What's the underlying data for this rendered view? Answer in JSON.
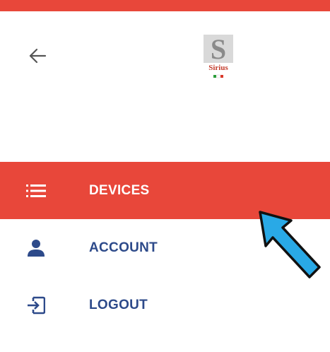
{
  "header": {
    "back_icon": "arrow-left-icon",
    "logo_text": "Sirius",
    "accent_color": "#e8473a"
  },
  "menu": {
    "items": [
      {
        "label": "DEVICES",
        "icon": "list-icon",
        "active": true
      },
      {
        "label": "ACCOUNT",
        "icon": "person-icon",
        "active": false
      },
      {
        "label": "LOGOUT",
        "icon": "logout-icon",
        "active": false
      }
    ]
  },
  "colors": {
    "active_background": "#e8473a",
    "label_color": "#2d4a8a",
    "pointer_fill": "#29a9e6"
  }
}
